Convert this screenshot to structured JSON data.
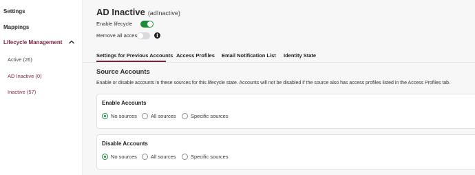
{
  "sidebar": {
    "settings": "Settings",
    "mappings": "Mappings",
    "lifecycle_management": "Lifecycle Management",
    "items": [
      {
        "label": "Active (26)"
      },
      {
        "label": "AD Inactive (0)"
      },
      {
        "label": "Inactive (57)"
      }
    ]
  },
  "header": {
    "title": "AD Inactive",
    "subtitle": "(adInactive)"
  },
  "toggles": {
    "enable_lifecycle": {
      "label": "Enable lifecycle",
      "on": true
    },
    "remove_all_access": {
      "label": "Remove all access",
      "on": false
    }
  },
  "tabs": [
    {
      "label": "Settings for Previous Accounts",
      "active": true
    },
    {
      "label": "Access Profiles",
      "active": false
    },
    {
      "label": "Email Notification List",
      "active": false
    },
    {
      "label": "Identity State",
      "active": false
    }
  ],
  "source_accounts": {
    "title": "Source Accounts",
    "description": "Enable or disable accounts in these sources for this lifecycle state. Accounts will not be disabled if the source also has access profiles listed in the Access Profiles tab."
  },
  "enable_accounts": {
    "title": "Enable Accounts",
    "options": [
      "No sources",
      "All sources",
      "Specific sources"
    ],
    "selected": "No sources"
  },
  "disable_accounts": {
    "title": "Disable Accounts",
    "options": [
      "No sources",
      "All sources",
      "Specific sources"
    ],
    "selected": "No sources"
  },
  "colors": {
    "accent": "#7a1f3d",
    "toggle_on": "#1f8a3a",
    "radio_selected": "#1f8a3a"
  }
}
